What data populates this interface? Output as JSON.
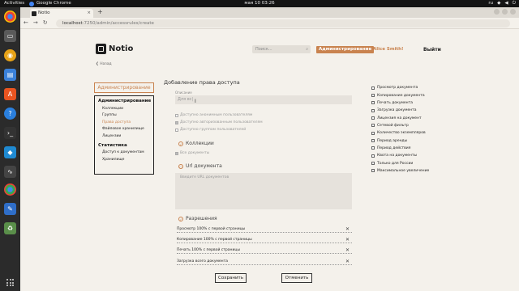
{
  "system": {
    "activities": "Activities",
    "app_name": "Google Chrome",
    "clock": "мая 10  03:26",
    "lang": "ru"
  },
  "browser": {
    "tab_title": "Notio",
    "url_host": "localhost",
    "url_path": ":7250/admin/accessrules/create"
  },
  "header": {
    "logo_text": "Notio",
    "search_placeholder": "Поиск...",
    "admin_label": "Администрирование",
    "user_name": "Alice Smith!",
    "logout_label": "Выйти",
    "back_label": "Назад"
  },
  "sidebar": {
    "admin_button": "Администрирование",
    "section_admin": "Администрирование",
    "items": [
      "Коллекции",
      "Группы",
      "Права доступа",
      "Файловое хранилище",
      "Лицензии"
    ],
    "section_stats": "Статистика",
    "stats_items": [
      "Доступ к документам",
      "Хранилище"
    ]
  },
  "form": {
    "title": "Добавление права доступа",
    "desc_label": "Описание",
    "desc_value": "Для вс|",
    "checkboxes": [
      {
        "label": "Доступно анонимным пользователям",
        "checked": false
      },
      {
        "label": "Доступно авторизованным пользователям",
        "checked": true
      },
      {
        "label": "Доступно группам пользователей",
        "checked": false
      }
    ],
    "collections_label": "Коллекции",
    "all_docs_label": "Все документы",
    "url_docs_label": "Url документа",
    "url_placeholder": "Введите URL документов",
    "permissions_label": "Разрешения",
    "permissions": [
      "Просмотр 100% с первой страницы",
      "Копирование 100% с первой страницы",
      "Печать 100% с первой страницы",
      "Загрузка всего документа"
    ],
    "save_label": "Сохранить",
    "cancel_label": "Отменить"
  },
  "rights": [
    "Просмотр документа",
    "Копирование документа",
    "Печать документа",
    "Загрузка документа",
    "Лицензия на документ",
    "Сетевой фильтр",
    "Количество экземпляров",
    "Период аренды",
    "Период действия",
    "Квота на документы",
    "Только для России",
    "Максимальное увеличение"
  ],
  "colors": {
    "accent": "#c9834f",
    "page_bg": "#f4f1eb",
    "input_bg": "#e6e2dc"
  }
}
